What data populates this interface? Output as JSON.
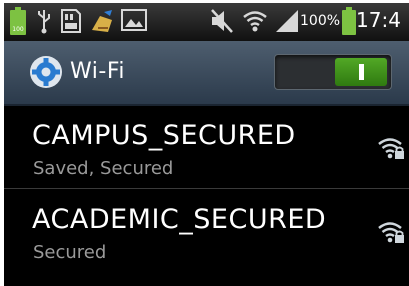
{
  "status_bar": {
    "battery_percent": "100%",
    "time": "17:4",
    "icons": [
      "battery-full-icon",
      "usb-icon",
      "sd-card-icon",
      "flag-cleaner-icon",
      "image-icon",
      "mute-icon",
      "wifi-icon",
      "signal-icon",
      "battery-icon"
    ]
  },
  "header": {
    "title": "Wi-Fi",
    "toggle_state": "on",
    "toggle_color": "#3f8f1b"
  },
  "networks": [
    {
      "ssid": "CAMPUS_SECURED",
      "status": "Saved, Secured",
      "icon": "wifi-lock-icon"
    },
    {
      "ssid": "ACADEMIC_SECURED",
      "status": "Secured",
      "icon": "wifi-lock-icon"
    }
  ]
}
